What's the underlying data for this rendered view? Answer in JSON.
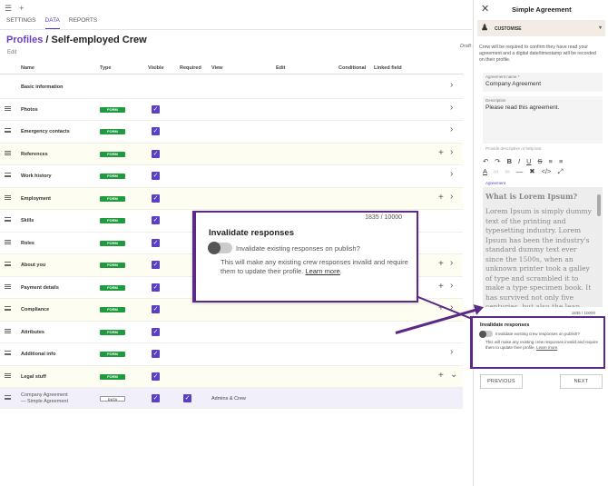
{
  "topbar": {
    "menu_icon": "hamburger-icon",
    "plus": "+"
  },
  "tabs": [
    {
      "label": "SETTINGS"
    },
    {
      "label": "DATA"
    },
    {
      "label": "REPORTS"
    }
  ],
  "header": {
    "crumb": "Profiles",
    "sep": " / ",
    "title": "Self-employed Crew",
    "edit": "Edit",
    "draft": "Draft s"
  },
  "columns": {
    "name": "Name",
    "type": "Type",
    "visible": "Visible",
    "required": "Required",
    "view": "View",
    "edit": "Edit",
    "conditional": "Conditional",
    "linked": "Linked field"
  },
  "rows": [
    {
      "name": "Basic information"
    },
    {
      "name": "Photos",
      "type": "FORM"
    },
    {
      "name": "Emergency contacts",
      "type": "FORM"
    },
    {
      "name": "References",
      "type": "FORM"
    },
    {
      "name": "Work history",
      "type": "FORM"
    },
    {
      "name": "Employment",
      "type": "FORM"
    },
    {
      "name": "Skills",
      "type": "FORM"
    },
    {
      "name": "Roles",
      "type": "FORM"
    },
    {
      "name": "About you",
      "type": "FORM"
    },
    {
      "name": "Payment details",
      "type": "FORM"
    },
    {
      "name": "Compliance",
      "type": "FORM"
    },
    {
      "name": "Attributes",
      "type": "FORM"
    },
    {
      "name": "Additional info",
      "type": "FORM"
    },
    {
      "name": "Legal stuff",
      "type": "FORM"
    },
    {
      "name": "Company Agreement",
      "subname": "— Simple Agreement",
      "type": "DATA",
      "view": "Admins & Crew"
    }
  ],
  "popup_large": {
    "counter": "1835 / 10000",
    "title": "Invalidate responses",
    "toggle_label": "Invalidate existing responses on publish?",
    "desc": "This will make any existing crew responses invalid and require them to update their profile.",
    "link": "Learn more"
  },
  "panel": {
    "title": "Simple Agreement",
    "customise": "CUSTOMISE",
    "intro": "Crew will be required to confirm they have read your agreement and a digital date/timestamp will be recorded on their profile.",
    "name_label": "Agreement name *",
    "name_value": "Company Agreement",
    "desc_label": "Description",
    "desc_value": "Please read this agreement.",
    "hint": "Provide descriptive or help text",
    "editor_label": "Agreement",
    "editor_heading": "What is Lorem Ipsum?",
    "editor_body": "Lorem Ipsum is simply dummy text of the printing and typesetting industry. Lorem Ipsum has been the industry's standard dummy text ever since the 1500s, when an unknown printer took a galley of type and scrambled it to make a type specimen book. It has survived not only five centuries, but also the leap into electronic",
    "counter": "1835 / 10000",
    "prev": "PREVIOUS",
    "next": "NEXT"
  },
  "popup_small": {
    "title": "Invalidate responses",
    "toggle_label": "Invalidate existing crew responses on publish?",
    "desc": "This will make any existing crew responses invalid and require them to update their profile.",
    "link": "Learn more"
  },
  "colors": {
    "accent": "#5b3fc4",
    "form_badge": "#1f9a3e",
    "annotation": "#5b2a86"
  }
}
